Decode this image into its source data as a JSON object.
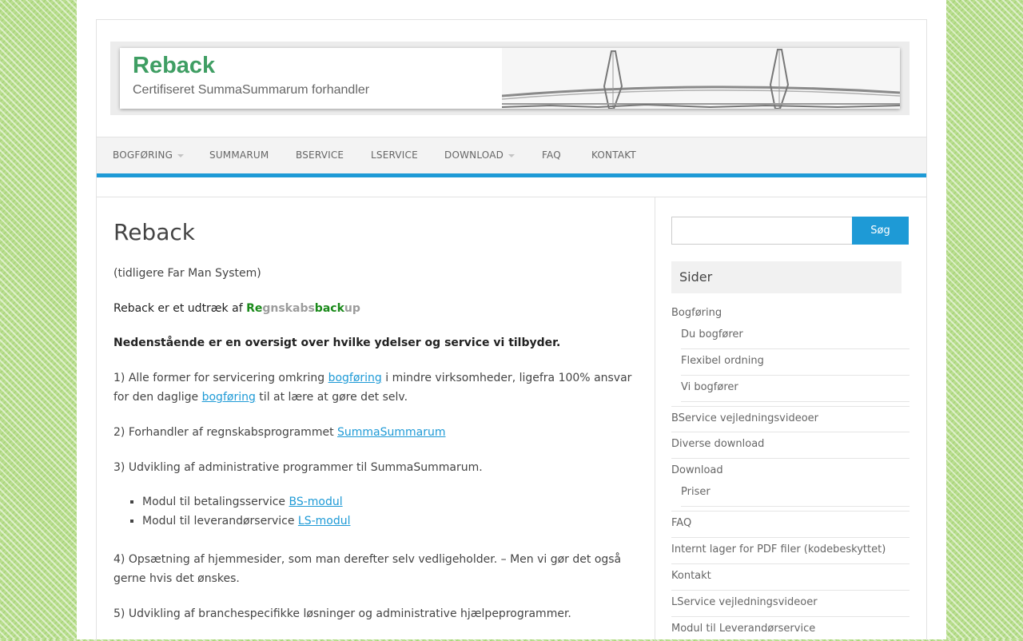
{
  "banner": {
    "title": "Reback",
    "subtitle": "Certifiseret SummaSummarum forhandler"
  },
  "nav": {
    "items": [
      {
        "label": "BOGFØRING",
        "has_dropdown": true
      },
      {
        "label": "SUMMARUM",
        "has_dropdown": false
      },
      {
        "label": "BSERVICE",
        "has_dropdown": false
      },
      {
        "label": "LSERVICE",
        "has_dropdown": false
      },
      {
        "label": "DOWNLOAD",
        "has_dropdown": true
      },
      {
        "label": "FAQ",
        "has_dropdown": false
      },
      {
        "label": "KONTAKT",
        "has_dropdown": false
      }
    ]
  },
  "article": {
    "title": "Reback",
    "intro": "(tidligere Far Man System)",
    "extract_prefix": "Reback er et udtræk af ",
    "brand": {
      "re": "Re",
      "gnskabs": "gnskabs",
      "back": "back",
      "up": "up"
    },
    "overview_heading": "Nedenstående er en oversigt over hvilke ydelser og service vi tilbyder.",
    "item1_a": "1) Alle former for servicering omkring ",
    "item1_link1": "bogføring",
    "item1_b": " i mindre virksomheder, ligefra 100% ansvar for den daglige ",
    "item1_link2": "bogføring",
    "item1_c": " til at lære at gøre det selv.",
    "item2_a": "2) Forhandler af regnskabsprogrammet ",
    "item2_link": "SummaSummarum",
    "item3": "3) Udvikling af administrative programmer til SummaSummarum.",
    "modules": [
      {
        "text": "Modul til betalingsservice ",
        "link": "BS-modul"
      },
      {
        "text": "Modul til leverandørservice ",
        "link": "LS-modul"
      }
    ],
    "item4": "4) Opsætning af hjemmesider, som man derefter selv vedligeholder. – Men vi gør det også gerne hvis det ønskes.",
    "item5": "5) Udvikling af branchespecifikke løsninger og administrative hjælpeprogrammer."
  },
  "sidebar": {
    "search_placeholder": "",
    "search_button": "Søg",
    "widget_title": "Sider",
    "pages": [
      {
        "label": "Bogføring",
        "level": 0
      },
      {
        "label": "Du bogfører",
        "level": 1
      },
      {
        "label": "Flexibel ordning",
        "level": 1
      },
      {
        "label": "Vi bogfører",
        "level": 1
      },
      {
        "label": "BService vejledningsvideoer",
        "level": 0
      },
      {
        "label": "Diverse download",
        "level": 0
      },
      {
        "label": "Download",
        "level": 0
      },
      {
        "label": "Priser",
        "level": 1
      },
      {
        "label": "FAQ",
        "level": 0
      },
      {
        "label": "Internt lager for PDF filer (kodebeskyttet)",
        "level": 0
      },
      {
        "label": "Kontakt",
        "level": 0
      },
      {
        "label": "LService vejledningsvideoer",
        "level": 0
      },
      {
        "label": "Modul til Leverandørservice",
        "level": 0
      }
    ]
  },
  "colors": {
    "accent": "#1e9ad6",
    "brand_green": "#1a8a1a",
    "banner_green": "#3f9e63",
    "background_pattern": "#b9de8e"
  }
}
